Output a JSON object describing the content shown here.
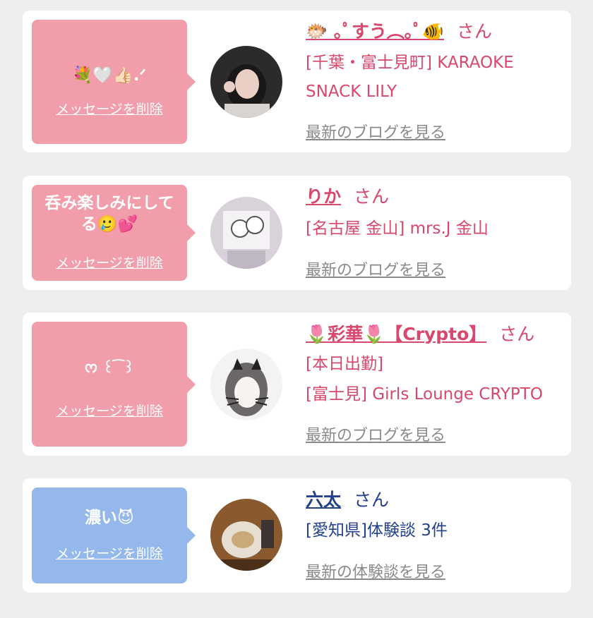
{
  "colors": {
    "bubble_pink": "#f19eaa",
    "bubble_blue": "#94b7ec",
    "name_pink": "#d9476c",
    "name_navy": "#233f8f",
    "link_gray": "#8a8a8a",
    "page_bg": "#eeeeee"
  },
  "cards": [
    {
      "message": "💐🤍👍🏻.ᐟ",
      "delete_label": "メッセージを削除",
      "avatar_icon": "woman-portrait-photo",
      "name": "🐡 ｡ﾟすう︵｡ﾟ🐠",
      "suffix": "さん",
      "lines": [
        "[千葉・富士見町] KARAOKE",
        "SNACK LILY"
      ],
      "link": "最新のブログを見る"
    },
    {
      "message": "呑み楽しみにしてる🥲💕",
      "delete_label": "メッセージを削除",
      "avatar_icon": "decorated-selfie-photo",
      "name": "りか",
      "suffix": "さん",
      "lines": [
        "[名古屋 金山] mrs.J 金山"
      ],
      "link": "最新のブログを見る"
    },
    {
      "message": "ᰔ ꒰ ͡   ꒱",
      "delete_label": "メッセージを削除",
      "avatar_icon": "cat-ear-filter-photo",
      "name": "🌷彩華🌷【Crypto】",
      "suffix": "さん",
      "lines": [
        "[本日出勤]",
        "[富士見] Girls Lounge CRYPTO"
      ],
      "link": "最新のブログを見る"
    },
    {
      "message": "濃い😈",
      "delete_label": "メッセージを削除",
      "avatar_icon": "dessert-plate-photo",
      "name": "六太",
      "suffix": "さん",
      "lines": [
        "[愛知県]体験談 3件"
      ],
      "link": "最新の体験談を見る"
    }
  ]
}
